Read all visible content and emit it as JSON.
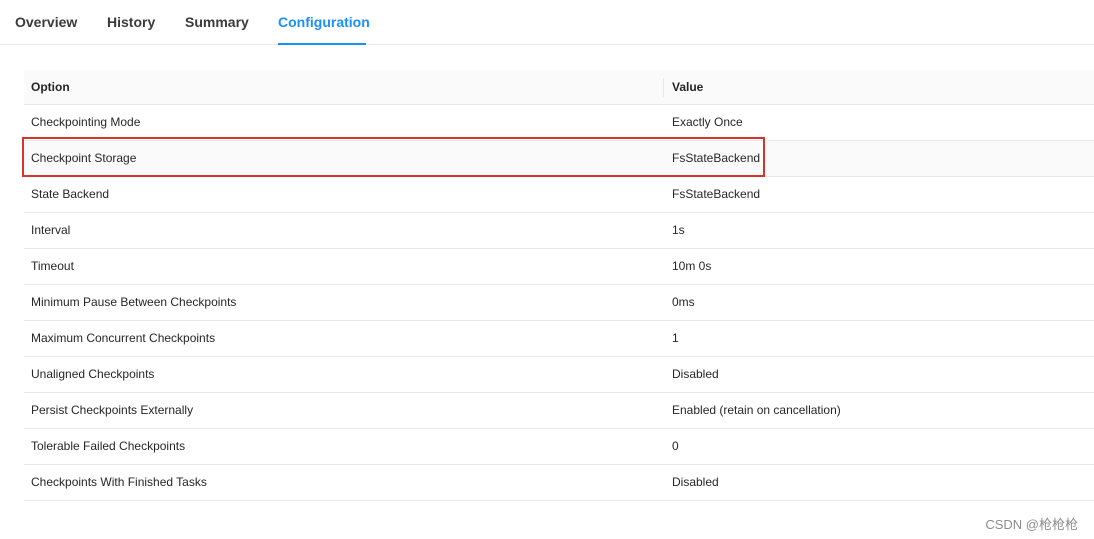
{
  "tabs": [
    {
      "label": "Overview"
    },
    {
      "label": "History"
    },
    {
      "label": "Summary"
    },
    {
      "label": "Configuration"
    }
  ],
  "active_tab": "Configuration",
  "table": {
    "headers": {
      "option": "Option",
      "value": "Value"
    },
    "rows": [
      {
        "option": "Checkpointing Mode",
        "value": "Exactly Once"
      },
      {
        "option": "Checkpoint Storage",
        "value": "FsStateBackend"
      },
      {
        "option": "State Backend",
        "value": "FsStateBackend"
      },
      {
        "option": "Interval",
        "value": "1s"
      },
      {
        "option": "Timeout",
        "value": "10m 0s"
      },
      {
        "option": "Minimum Pause Between Checkpoints",
        "value": "0ms"
      },
      {
        "option": "Maximum Concurrent Checkpoints",
        "value": "1"
      },
      {
        "option": "Unaligned Checkpoints",
        "value": "Disabled"
      },
      {
        "option": "Persist Checkpoints Externally",
        "value": "Enabled (retain on cancellation)"
      },
      {
        "option": "Tolerable Failed Checkpoints",
        "value": "0"
      },
      {
        "option": "Checkpoints With Finished Tasks",
        "value": "Disabled"
      }
    ]
  },
  "colors": {
    "accent": "#1890ff",
    "highlight_box": "#d9342b"
  },
  "watermark": "CSDN @枪枪枪"
}
